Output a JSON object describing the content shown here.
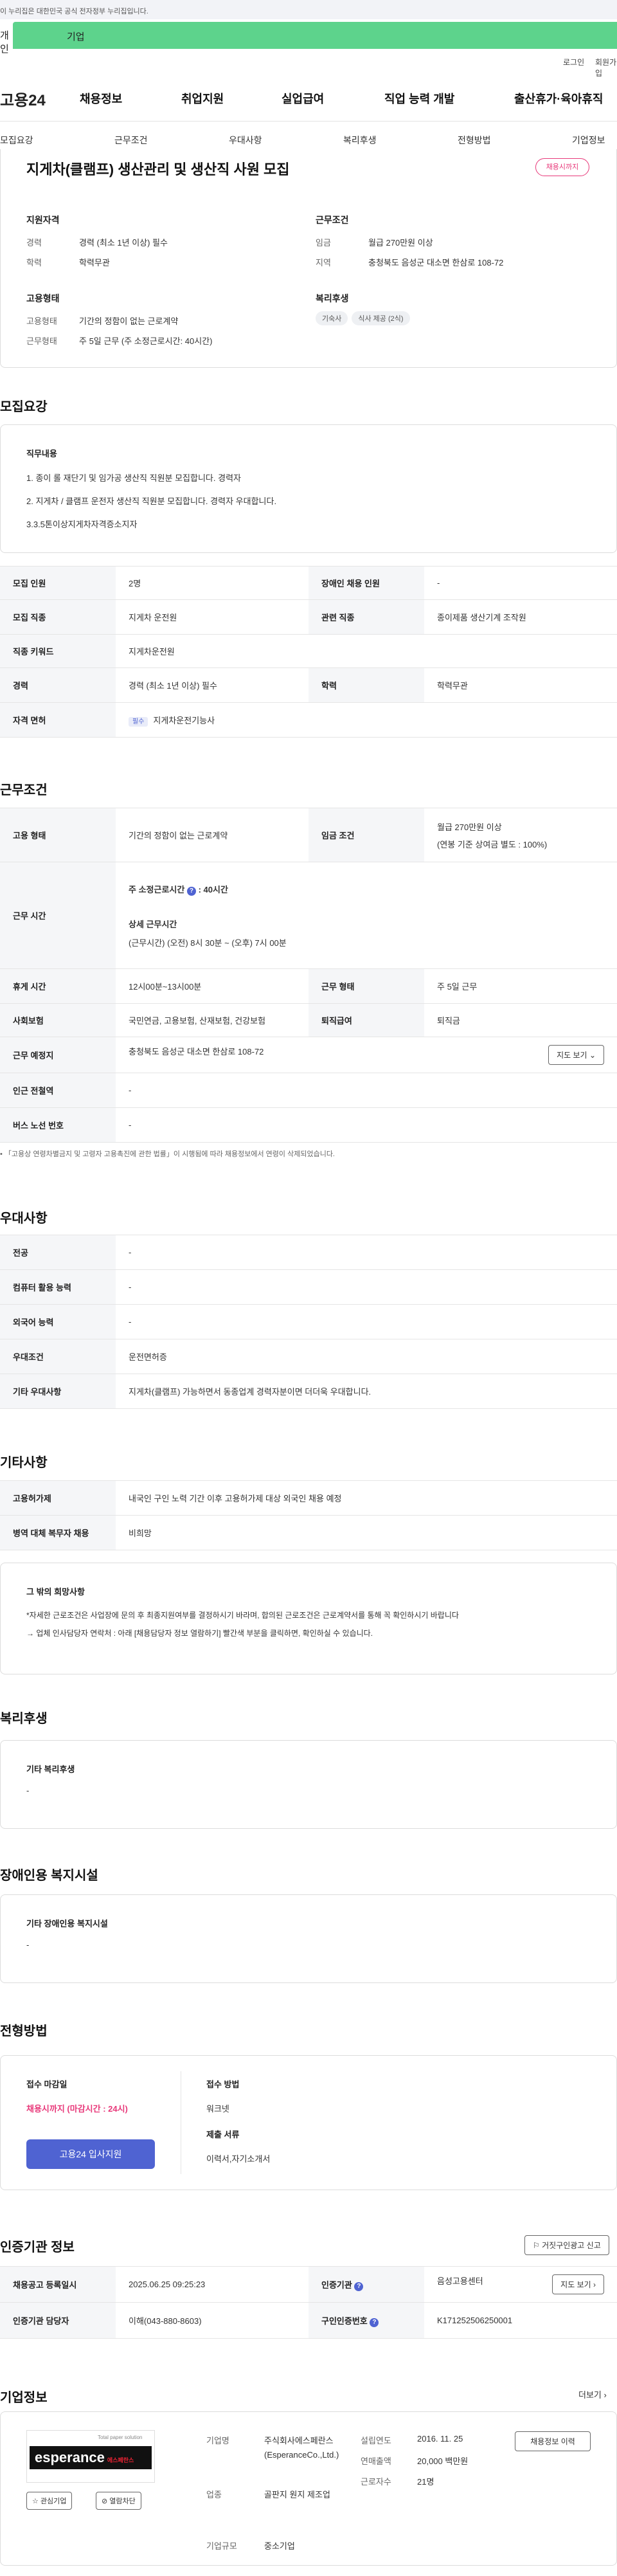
{
  "gov_banner": "이 누리집은 대한민국 공식 전자정부 누리집입니다.",
  "tabs": {
    "person": "개인",
    "business": "기업"
  },
  "util": {
    "login": "로그인",
    "join": "회원가입"
  },
  "logo": "고용24",
  "gnb": [
    "채용정보",
    "취업지원",
    "실업급여",
    "직업 능력 개발",
    "출산휴가·육아휴직"
  ],
  "subnav": [
    "모집요강",
    "근무조건",
    "우대사항",
    "복리후생",
    "전형방법",
    "기업정보"
  ],
  "job": {
    "title": "지게차(클램프) 생산관리 및 생산직 사원 모집",
    "status": "채용시까지",
    "qual_title": "지원자격",
    "career_k": "경력",
    "career_v": "경력 (최소 1년 이상) 필수",
    "edu_k": "학력",
    "edu_v": "학력무관",
    "cond_title": "근무조건",
    "wage_k": "임금",
    "wage_v": "월급 270만원 이상",
    "loc_k": "지역",
    "loc_v": "충청북도 음성군 대소면 한삼로 108-72",
    "emp_title": "고용형태",
    "emp_type_k": "고용형태",
    "emp_type_v": "기간의 정함이 없는 근로계약",
    "work_k": "근무형태",
    "work_v": "주 5일 근무 (주 소정근로시간: 40시간)",
    "welfare_title": "복리후생",
    "welfare_chips": [
      "기숙사",
      "식사 제공 (2식)"
    ]
  },
  "recruit": {
    "title": "모집요강",
    "duty_title": "직무내용",
    "duties": [
      "1. 종이 롤 재단기 및 임가공 생산직 직원분 모집합니다. 경력자",
      "2. 지게차 / 클램프 운전자 생산직 직원분 모집합니다. 경력자 우대합니다.",
      "3.3.5톤이상지게차자격증소지자"
    ],
    "rows": [
      [
        "모집 인원",
        "2명",
        "장애인 채용 인원",
        "-"
      ],
      [
        "모집 직종",
        "지게차 운전원",
        "관련 직종",
        "종이제품 생산기계 조작원"
      ],
      [
        "직종 키워드",
        "지게차운전원",
        "",
        ""
      ],
      [
        "경력",
        "경력 (최소 1년 이상) 필수",
        "학력",
        "학력무관"
      ]
    ],
    "license_k": "자격 면허",
    "license_tag": "필수",
    "license_v": "지게차운전기능사"
  },
  "conditions": {
    "title": "근무조건",
    "emp_k": "고용 형태",
    "emp_v": "기간의 정함이 없는 근로계약",
    "wage_k": "임금 조건",
    "wage_v1": "월급 270만원 이상",
    "wage_v2": "(연봉 기준 상여금 별도 : 100%)",
    "time_k": "근무 시간",
    "time_main": "주 소정근로시간",
    "time_main_v": ": 40시간",
    "time_detail_title": "상세 근무시간",
    "time_detail": "(근무시간) (오전) 8시 30분 ~ (오후) 7시 00분",
    "rest_k": "휴게 시간",
    "rest_v": "12시00분~13시00분",
    "shift_k": "근무 형태",
    "shift_v": "주 5일 근무",
    "ins_k": "사회보험",
    "ins_v": "국민연금, 고용보험, 산재보험, 건강보험",
    "ret_k": "퇴직급여",
    "ret_v": "퇴직금",
    "place_k": "근무 예정지",
    "place_v": "충청북도 음성군 대소면 한삼로 108-72",
    "map_btn": "지도 보기",
    "subway_k": "인근 전철역",
    "subway_v": "-",
    "bus_k": "버스 노선 번호",
    "bus_v": "-",
    "note": "「고용상 연령차별금지 및 고령자 고용촉진에 관한 법률」이 시행됨에 따라 채용정보에서 연령이 삭제되었습니다."
  },
  "pref": {
    "title": "우대사항",
    "rows": [
      [
        "전공",
        "-"
      ],
      [
        "컴퓨터 활용 능력",
        "-"
      ],
      [
        "외국어 능력",
        "-"
      ],
      [
        "우대조건",
        "운전면허증"
      ],
      [
        "기타 우대사항",
        "지게차(클램프) 가능하면서 동종업계 경력자분이면 더더욱 우대합니다."
      ]
    ]
  },
  "etc": {
    "title": "기타사항",
    "rows": [
      [
        "고용허가제",
        "내국인 구인 노력 기간 이후 고용허가제 대상 외국인 채용 예정"
      ],
      [
        "병역 대체 복무자 채용",
        "비희망"
      ]
    ],
    "box_title": "그 밖의 희망사항",
    "box_lines": [
      "*자세한 근로조건은 사업장에 문의 후 최종지원여부를 결정하시기 바라며, 합의된 근로조건은 근로계약서를 통해 꼭 확인하시기 바랍니다",
      "→ 업체 인사담당자 연락처 : 아래 [채용담당자 정보 열람하기] 빨간색 부분을 클릭하면, 확인하실 수 있습니다."
    ]
  },
  "welfare": {
    "title": "복리후생",
    "sub": "기타 복리후생",
    "value": "-"
  },
  "disabled": {
    "title": "장애인용 복지시설",
    "sub": "기타 장애인용 복지시설",
    "value": "-"
  },
  "process": {
    "title": "전형방법",
    "deadline_k": "접수 마감일",
    "deadline_v": "채용시까지 (마감시간 : 24시)",
    "apply_btn": "고용24 입사지원",
    "method_k": "접수 방법",
    "method_v": "워크넷",
    "docs_k": "제출 서류",
    "docs_v": "이력서,자기소개서"
  },
  "agency": {
    "title": "인증기관 정보",
    "report_btn": "거짓구인광고 신고",
    "r1": [
      "채용공고 등록일시",
      "2025.06.25 09:25:23",
      "인증기관",
      "음성고용센터"
    ],
    "map_btn": "지도 보기",
    "r2": [
      "인증기관 담당자",
      "이해(043-880-8603)",
      "구인인증번호",
      "K171252506250001"
    ]
  },
  "company": {
    "title": "기업정보",
    "more": "더보기",
    "logo_tag": "Total paper solution",
    "logo_main": "esperance",
    "logo_sub": "에스페란스",
    "fav_btn": "관심기업",
    "block_btn": "열람차단",
    "name_k": "기업명",
    "name_v": "주식회사에스페란스(EsperanceCo.,Ltd.)",
    "year_k": "설립연도",
    "year_v": "2016. 11. 25",
    "sales_k": "연매출액",
    "sales_v": "20,000 백만원",
    "staff_k": "근로자수",
    "staff_v": "21명",
    "biz_k": "업종",
    "biz_v": "골판지 원지 제조업",
    "size_k": "기업규모",
    "size_v": "중소기업",
    "jobs_btn": "채용정보 이력"
  },
  "colors": {
    "accent": "#5dd38c",
    "danger": "#e8397a",
    "primary": "#4f63d2"
  }
}
